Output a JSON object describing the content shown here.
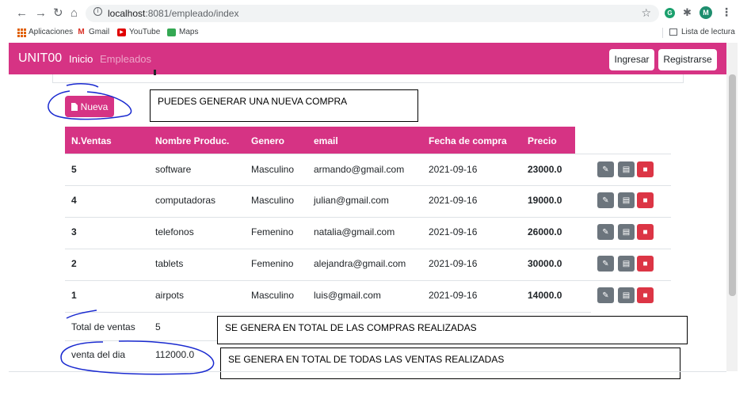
{
  "browser": {
    "url_host": "localhost",
    "url_rest": ":8081/empleado/index",
    "avatar_letter": "M",
    "ext_letter": "G",
    "bookmarks": [
      "Aplicaciones",
      "Gmail",
      "YouTube",
      "Maps"
    ],
    "reading_list": "Lista de lectura"
  },
  "navbar": {
    "brand": "UNIT00",
    "link_home": "Inicio",
    "link_employees": "Empleados",
    "login_label": "Ingresar",
    "register_label": "Registrarse",
    "color": "#d63384"
  },
  "actions": {
    "new_label": "Nueva"
  },
  "annotations": {
    "new_note": "PUEDES GENERAR UNA NUEVA COMPRA",
    "count_note": "SE GENERA EN TOTAL DE LAS COMPRAS REALIZADAS",
    "total_note": "SE GENERA EN TOTAL DE TODAS LAS VENTAS REALIZADAS"
  },
  "table": {
    "headers": [
      "N.Ventas",
      "Nombre Produc.",
      "Genero",
      "email",
      "Fecha de compra",
      "Precio"
    ],
    "rows": [
      {
        "n": "5",
        "product": "software",
        "gender": "Masculino",
        "email": "armando@gmail.com",
        "date": "2021-09-16",
        "price": "23000.0"
      },
      {
        "n": "4",
        "product": "computadoras",
        "gender": "Masculino",
        "email": "julian@gmail.com",
        "date": "2021-09-16",
        "price": "19000.0"
      },
      {
        "n": "3",
        "product": "telefonos",
        "gender": "Femenino",
        "email": "natalia@gmail.com",
        "date": "2021-09-16",
        "price": "26000.0"
      },
      {
        "n": "2",
        "product": "tablets",
        "gender": "Femenino",
        "email": "alejandra@gmail.com",
        "date": "2021-09-16",
        "price": "30000.0"
      },
      {
        "n": "1",
        "product": "airpots",
        "gender": "Masculino",
        "email": "luis@gmail.com",
        "date": "2021-09-16",
        "price": "14000.0"
      }
    ]
  },
  "summary": {
    "count_label": "Total de ventas",
    "count_value": "5",
    "total_label": "venta del dia",
    "total_value": "112000.0"
  }
}
